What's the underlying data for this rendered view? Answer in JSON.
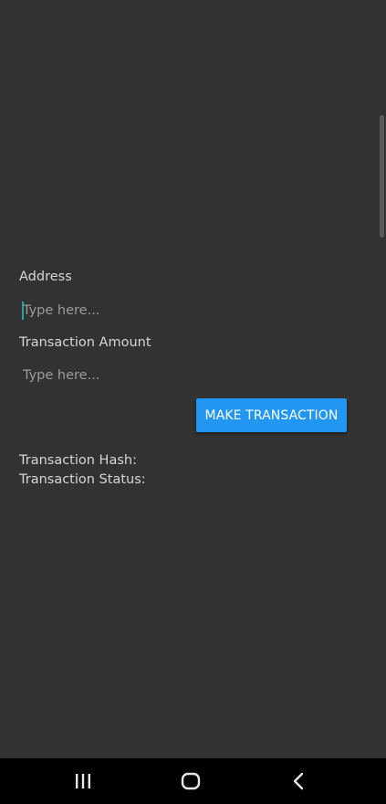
{
  "form": {
    "address_label": "Address",
    "address_value": "",
    "address_placeholder": "Type here...",
    "amount_label": "Transaction Amount",
    "amount_value": "",
    "amount_placeholder": "Type here...",
    "submit_label": "MAKE TRANSACTION"
  },
  "result": {
    "hash_label": "Transaction Hash:",
    "status_label": "Transaction Status:"
  },
  "navigation": {
    "recents_icon": "recents-icon",
    "home_icon": "home-icon",
    "back_icon": "back-icon"
  },
  "colors": {
    "background": "#323232",
    "accent": "#2196f3",
    "caret": "#26a69a",
    "navbar": "#000000"
  }
}
